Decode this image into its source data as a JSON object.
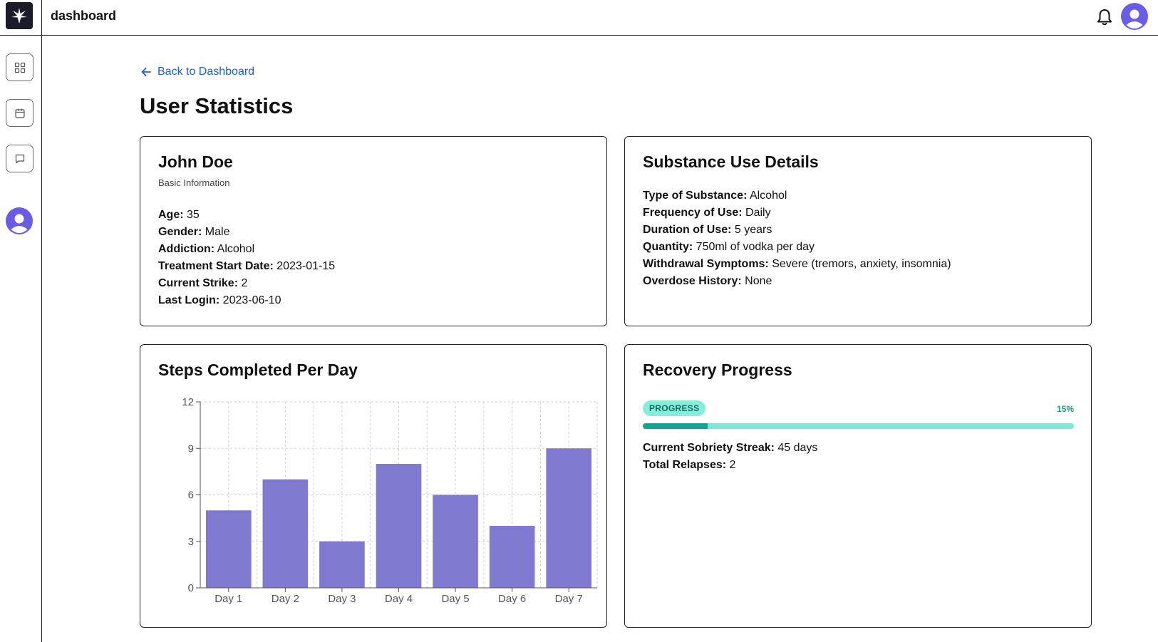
{
  "header": {
    "app_title": "dashboard",
    "icons": [
      "logo-icon",
      "bell-icon",
      "user-avatar-icon"
    ]
  },
  "sidebar": {
    "items": [
      {
        "name": "grid-icon"
      },
      {
        "name": "calendar-icon"
      },
      {
        "name": "message-icon"
      },
      {
        "name": "user-avatar-icon"
      }
    ]
  },
  "main": {
    "back_link": "Back to Dashboard",
    "page_title": "User Statistics"
  },
  "basic_info": {
    "name": "John Doe",
    "subtitle": "Basic Information",
    "fields": [
      {
        "label": "Age:",
        "value": "35"
      },
      {
        "label": "Gender:",
        "value": "Male"
      },
      {
        "label": "Addiction:",
        "value": "Alcohol"
      },
      {
        "label": "Treatment Start Date:",
        "value": "2023-01-15"
      },
      {
        "label": "Current Strike:",
        "value": "2"
      },
      {
        "label": "Last Login:",
        "value": "2023-06-10"
      }
    ]
  },
  "substance": {
    "title": "Substance Use Details",
    "fields": [
      {
        "label": "Type of Substance:",
        "value": "Alcohol"
      },
      {
        "label": "Frequency of Use:",
        "value": "Daily"
      },
      {
        "label": "Duration of Use:",
        "value": "5 years"
      },
      {
        "label": "Quantity:",
        "value": "750ml of vodka per day"
      },
      {
        "label": "Withdrawal Symptoms:",
        "value": "Severe (tremors, anxiety, insomnia)"
      },
      {
        "label": "Overdose History:",
        "value": "None"
      }
    ]
  },
  "steps_card": {
    "title": "Steps Completed Per Day"
  },
  "chart_data": {
    "type": "bar",
    "categories": [
      "Day 1",
      "Day 2",
      "Day 3",
      "Day 4",
      "Day 5",
      "Day 6",
      "Day 7"
    ],
    "values": [
      5,
      7,
      3,
      8,
      6,
      4,
      9
    ],
    "yticks": [
      0,
      3,
      6,
      9,
      12
    ],
    "ylim": [
      0,
      12
    ],
    "grid": true,
    "bar_color": "#8079d0"
  },
  "recovery": {
    "title": "Recovery Progress",
    "badge": "PROGRESS",
    "percent_label": "15%",
    "progress": 0.15,
    "fields": [
      {
        "label": "Current Sobriety Streak:",
        "value": "45 days"
      },
      {
        "label": "Total Relapses:",
        "value": "2"
      }
    ]
  },
  "colors": {
    "accent_link": "#1d5fd1",
    "avatar": "#6b5ce7",
    "progress_track": "#7fe8d8",
    "progress_fill": "#14a393"
  }
}
